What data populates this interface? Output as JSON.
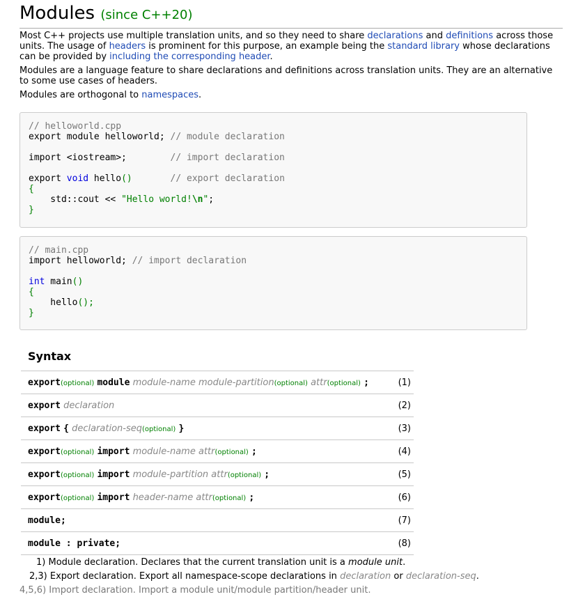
{
  "title": {
    "main": "Modules",
    "since": "(since C++20)"
  },
  "intro": {
    "p1": {
      "t1": "Most C++ projects use multiple translation units, and so they need to share ",
      "l1": "declarations",
      "t2": " and ",
      "l2": "definitions",
      "t3": " across those units. The usage of ",
      "l3": "headers",
      "t4": " is prominent for this purpose, an example being the ",
      "l4": "standard library",
      "t5": " whose declarations can be provided by ",
      "l5": "including the corresponding header",
      "t6": "."
    },
    "p2": "Modules are a language feature to share declarations and definitions across translation units. They are an alternative to some use cases of headers.",
    "p3": {
      "t1": "Modules are orthogonal to ",
      "l1": "namespaces",
      "t2": "."
    }
  },
  "code1": {
    "l1": "// helloworld.cpp",
    "l2a": "export module helloworld; ",
    "l2c": "// module declaration",
    "l3a": "import <iostream>;        ",
    "l3c": "// import declaration",
    "l4a": "export ",
    "l4k": "void",
    "l4b": " hello",
    "l4p": "()",
    "l4s": "       ",
    "l4c": "// export declaration",
    "l5": "{",
    "l6a": "    std::cout << ",
    "l6s": "\"Hello world!",
    "l6e": "\\n",
    "l6q": "\"",
    "l6z": ";",
    "l7": "}"
  },
  "code2": {
    "l1": "// main.cpp",
    "l2a": "import helloworld; ",
    "l2c": "// import declaration",
    "l3k": "int",
    "l3b": " main",
    "l3p": "()",
    "l4": "{",
    "l5a": "    hello",
    "l5p": "();",
    "l6": "}"
  },
  "syntax": {
    "heading": "Syntax",
    "optional": "(optional)",
    "kw_export": "export",
    "kw_module": "module",
    "kw_import": "import",
    "semicolon": ";",
    "brace_open": "{",
    "brace_close": "}",
    "module_name": "module-name",
    "module_partition": "module-partition",
    "attr": "attr",
    "declaration": "declaration",
    "declaration_seq": "declaration-seq",
    "header_name": "header-name",
    "module_semicolon": "module;",
    "module_private": "module : private;",
    "nums": [
      "(1)",
      "(2)",
      "(3)",
      "(4)",
      "(5)",
      "(6)",
      "(7)",
      "(8)"
    ]
  },
  "notes": {
    "n1a": "1) Module declaration. Declares that the current translation unit is a ",
    "n1b": "module unit",
    "n1c": ".",
    "n2a": "2,3) Export declaration. Export all namespace-scope declarations in ",
    "n2b": "declaration",
    "n2c": " or ",
    "n2d": "declaration-seq",
    "n2e": ".",
    "n3": "4,5,6) Import declaration. Import a module unit/module partition/header unit."
  }
}
